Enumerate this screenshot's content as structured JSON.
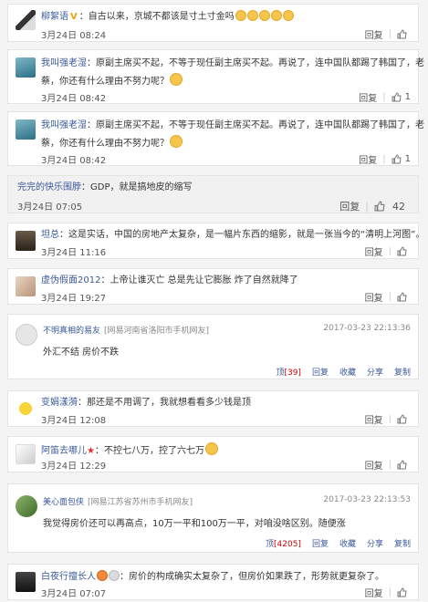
{
  "comments": [
    {
      "name": "柳絮语",
      "text": "：自古以来，京城不都该是寸土寸金吗",
      "time": "3月24日 08:24",
      "reply": "回复",
      "likes": ""
    },
    {
      "name": "我叫强老湿",
      "text": "：原副主席买不起，不等于现任副主席买不起。再说了，连中国队都踢了韩国了，老",
      "text2": "蔡，你还有什么理由不努力呢？",
      "time": "3月24日 08:42",
      "reply": "回复",
      "likes": "1"
    },
    {
      "name": "我叫强老湿",
      "text": "：原副主席买不起，不等于现任副主席买不起。再说了，连中国队都踢了韩国了，老",
      "text2": "蔡，你还有什么理由不努力呢？",
      "time": "3月24日 08:42",
      "reply": "回复",
      "likes": "1"
    },
    {
      "name": "完完的快乐围脖",
      "text": "：GDP，就是搞地皮的缩写",
      "time": "3月24日 07:05",
      "reply": "回复",
      "likes": "42"
    },
    {
      "name": "坦总",
      "text": "：这是实话，中国的房地产太复杂，是一幅片东西的缩影，就是一张当今的“清明上河图”。",
      "time": "3月24日 11:16",
      "reply": "回复",
      "likes": ""
    },
    {
      "name": "虚伪假面2012",
      "text": "：上帝让谁灭亡 总是先让它膨胀 炸了自然就降了",
      "time": "3月24日 19:27",
      "reply": "回复",
      "likes": ""
    },
    {
      "name": "变娟漾漪",
      "text": "：那还是不用调了，我就想看看多少钱是顶",
      "time": "3月24日 12:08",
      "reply": "回复",
      "likes": ""
    },
    {
      "name": "阿笛去哪儿",
      "text": "：不控七八万，控了六七万",
      "time": "3月24日 12:29",
      "reply": "回复",
      "likes": ""
    },
    {
      "name": "白夜行擅长人",
      "text": "：房价的构成确实太复杂了，但房价如果跌了，形势就更复杂了。",
      "time": "3月24日 07:07",
      "reply": "回复",
      "likes": ""
    }
  ],
  "n163": [
    {
      "user": "不明真相的易友",
      "loc": "[网易河南省洛阳市手机网友]",
      "date": "2017-03-23 22:13:36",
      "body": "外汇不结 房价不跌",
      "ding": "顶",
      "ding_count": "[39]",
      "reply": "回复",
      "collect": "收藏",
      "share": "分享",
      "copy": "复制"
    },
    {
      "user": "美心面包侠",
      "loc": "[网易江苏省苏州市手机网友]",
      "date": "2017-03-23 22:13:53",
      "body": "我觉得房价还可以再高点，10万一平和100万一平，对咱没啥区别。随便涨",
      "ding": "顶",
      "ding_count": "[4205]",
      "reply": "回复",
      "collect": "收藏",
      "share": "分享",
      "copy": "复制"
    }
  ]
}
